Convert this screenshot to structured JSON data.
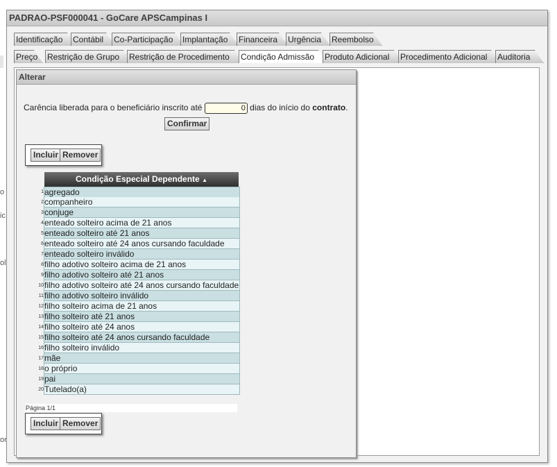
{
  "window": {
    "title": "PADRAO-PSF000041 - GoCare APSCampinas I"
  },
  "edge_fragments": [
    "o",
    "ic",
    "ol",
    "or"
  ],
  "tabs_row1": [
    "Identificação",
    "Contábil",
    "Co-Participação",
    "Implantação",
    "Financeira",
    "Urgência",
    "Reembolso"
  ],
  "tabs_row2": [
    "Preço",
    "Restrição de Grupo",
    "Restrição de Procedimento",
    "Condição Admissão",
    "Produto Adicional",
    "Procedimento Adicional",
    "Auditoria"
  ],
  "active_tab": "Condição Admissão",
  "panel": {
    "header": "Alterar",
    "carencia_text": "Carência liberada para o beneficiário inscrito até",
    "carencia_value": "0",
    "carencia_suffix": "dias do início do",
    "carencia_bold": "contrato",
    "carencia_end": ".",
    "confirm_label": "Confirmar",
    "include_label": "Incluir",
    "remove_label": "Remover"
  },
  "grid": {
    "column_header": "Condição Especial Dependente",
    "sort_indicator": "▲",
    "rows": [
      "agregado",
      "companheiro",
      "conjuge",
      "enteado solteiro acima de 21 anos",
      "enteado solteiro até 21 anos",
      "enteado solteiro até 24 anos cursando faculdade",
      "enteado solteiro inválido",
      "filho adotivo solteiro acima de 21 anos",
      "filho adotivo solteiro até 21 anos",
      "filho adotivo solteiro até 24 anos cursando faculdade",
      "filho adotivo solteiro inválido",
      "filho solteiro acima de 21 anos",
      "filho solteiro até 21 anos",
      "filho solteiro até 24 anos",
      "filho solteiro até 24 anos cursando faculdade",
      "filho solteiro inválido",
      "mãe",
      "o próprio",
      "pai",
      "Tutelado(a)"
    ],
    "pager": "Página 1/1"
  },
  "colors": {
    "row_odd": "#c9dfe2",
    "row_even": "#e8f4f6",
    "header_dark": "#2f2f2f"
  }
}
